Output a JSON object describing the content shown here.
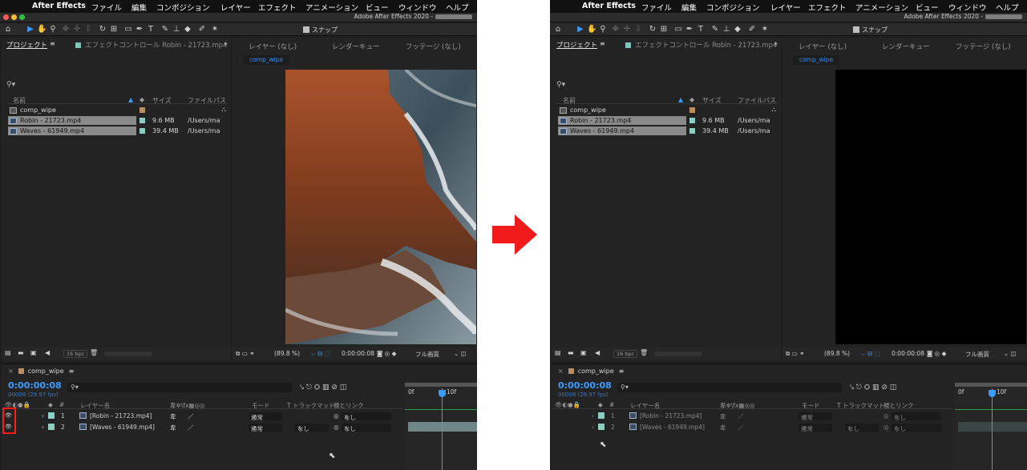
{
  "menubar": {
    "apple": "",
    "app": "After Effects",
    "items": [
      "ファイル",
      "編集",
      "コンポジション",
      "レイヤー",
      "エフェクト",
      "アニメーション",
      "ビュー",
      "ウィンドウ",
      "ヘルプ"
    ]
  },
  "window_title": "Adobe After Effects 2020 -",
  "toolbar": {
    "snap_label": "スナップ"
  },
  "project_panel": {
    "tab": "プロジェクト",
    "effect_tab": "エフェクトコントロール Robin - 21723.mp4",
    "columns": {
      "name": "名前",
      "size": "サイズ",
      "path": "ファイルパス"
    },
    "items": [
      {
        "name": "comp_wipe",
        "size": "",
        "path": "",
        "label_color": "#b78e5c"
      },
      {
        "name": "Robin - 21723.mp4",
        "size": "9.6 MB",
        "path": "/Users/ma",
        "label_color": "#8ccfc2"
      },
      {
        "name": "Waves - 61949.mp4",
        "size": "39.4 MB",
        "path": "/Users/ma",
        "label_color": "#8ccfc2"
      }
    ],
    "bpc": "16 bpc"
  },
  "viewer": {
    "tabs": [
      "レイヤー (なし)",
      "レンダーキュー",
      "フッテージ (なし)"
    ],
    "comp_button": "comp_wipe",
    "zoom": "(89.8 %)",
    "timecode": "0:00:00:08",
    "quality": "フル画質"
  },
  "timeline": {
    "tab": "comp_wipe",
    "timecode": "0:00:00:08",
    "fps": "00008 (29.97 fps)",
    "ruler": {
      "start": "0f",
      "mark": "10f"
    },
    "columns": {
      "num": "#",
      "layer_name": "レイヤー名",
      "mode": "モード",
      "trkmat": "T  トラックマット",
      "parent": "親とリンク"
    },
    "layers": [
      {
        "num": "1",
        "name": "[Robin - 21723.mp4]",
        "mode": "通常",
        "trkmat": "",
        "parent": "なし"
      },
      {
        "num": "2",
        "name": "[Waves - 61949.mp4]",
        "mode": "通常",
        "trkmat": "なし",
        "parent": "なし"
      }
    ]
  },
  "colors": {
    "accent": "#3b9cff",
    "highlight": "#ff1a1a",
    "arrow": "#f21b1b"
  }
}
